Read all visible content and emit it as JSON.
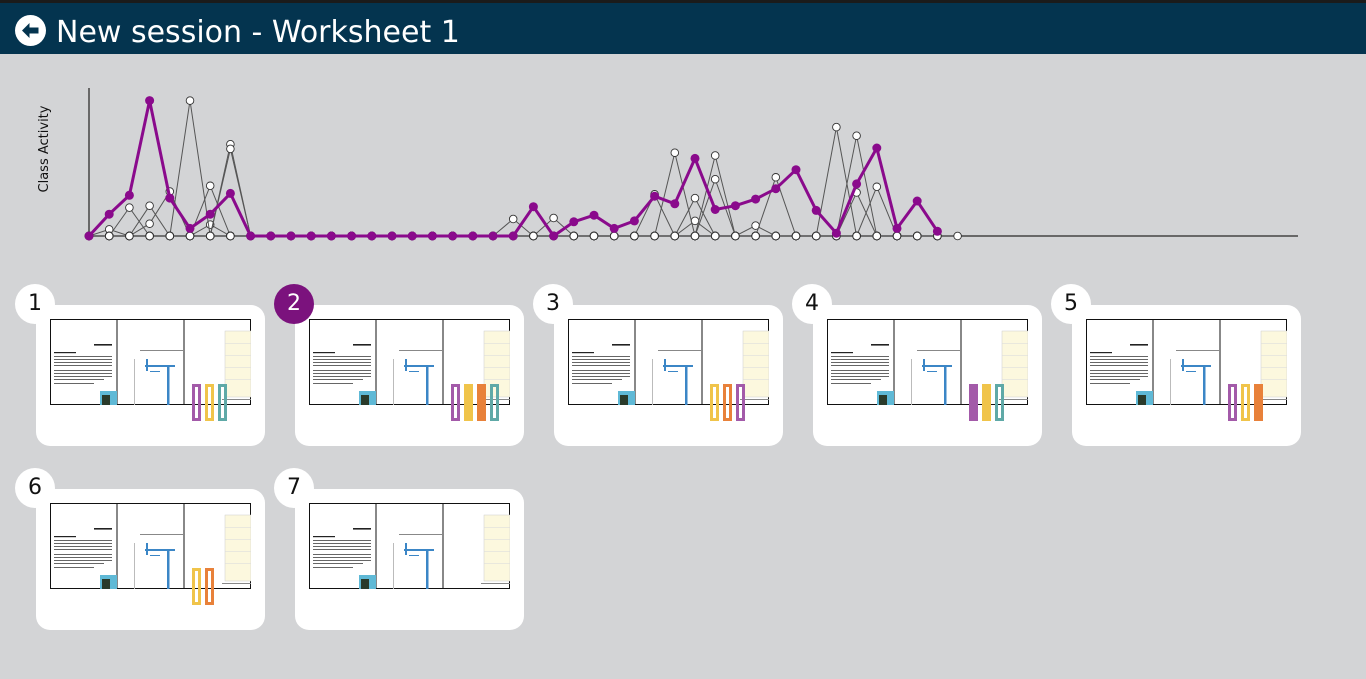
{
  "header": {
    "title": "New session - Worksheet 1",
    "back_icon": "back-arrow-icon"
  },
  "chart_data": {
    "type": "line",
    "ylabel": "Class Activity",
    "xlabel": "",
    "title": "",
    "x_count": 43,
    "ylim": [
      0,
      150
    ],
    "grid": false,
    "highlight_color": "#8a0a8c",
    "student_color": "#555555",
    "highlight": [
      0,
      23,
      43,
      143,
      40,
      8,
      23,
      45,
      0,
      0,
      0,
      0,
      0,
      0,
      0,
      0,
      0,
      0,
      0,
      0,
      0,
      0,
      31,
      0,
      15,
      22,
      8,
      16,
      42,
      34,
      82,
      28,
      32,
      39,
      50,
      70,
      27,
      3,
      55,
      93,
      8,
      37,
      5
    ],
    "students": [
      [
        0,
        7,
        0,
        0,
        0,
        0,
        12,
        0,
        0,
        0,
        0,
        0,
        0,
        0,
        0,
        0,
        0,
        0,
        0,
        0,
        0,
        0,
        0,
        0,
        0,
        0,
        0,
        0,
        0,
        0,
        16,
        0,
        0,
        11,
        0,
        0,
        0,
        0,
        46,
        0,
        0,
        0,
        0
      ],
      [
        0,
        0,
        30,
        0,
        0,
        0,
        0,
        0,
        0,
        0,
        0,
        0,
        0,
        0,
        0,
        0,
        0,
        0,
        0,
        0,
        0,
        0,
        0,
        0,
        0,
        0,
        0,
        0,
        0,
        0,
        40,
        0,
        0,
        0,
        0,
        0,
        0,
        0,
        0,
        0,
        0,
        0,
        0
      ],
      [
        0,
        0,
        0,
        0,
        0,
        143,
        0,
        0,
        0,
        0,
        0,
        0,
        0,
        0,
        0,
        0,
        0,
        0,
        0,
        0,
        0,
        0,
        0,
        0,
        0,
        0,
        0,
        0,
        0,
        0,
        0,
        0,
        0,
        0,
        0,
        0,
        0,
        115,
        0,
        0,
        0,
        0,
        0
      ],
      [
        0,
        0,
        0,
        0,
        0,
        0,
        0,
        97,
        0,
        0,
        0,
        0,
        0,
        0,
        0,
        0,
        0,
        0,
        0,
        0,
        0,
        0,
        0,
        0,
        0,
        0,
        0,
        0,
        0,
        0,
        0,
        0,
        0,
        0,
        0,
        0,
        0,
        0,
        106,
        0,
        0,
        0,
        0
      ],
      [
        0,
        0,
        0,
        32,
        0,
        0,
        0,
        0,
        0,
        0,
        0,
        0,
        0,
        0,
        0,
        0,
        0,
        0,
        0,
        0,
        0,
        0,
        0,
        0,
        0,
        0,
        0,
        0,
        0,
        0,
        0,
        0,
        0,
        0,
        0,
        0,
        0,
        0,
        0,
        0,
        0,
        0,
        0
      ],
      [
        0,
        0,
        0,
        0,
        0,
        0,
        53,
        0,
        0,
        0,
        0,
        0,
        0,
        0,
        0,
        0,
        0,
        0,
        0,
        0,
        0,
        0,
        0,
        0,
        0,
        0,
        0,
        0,
        0,
        0,
        0,
        0,
        0,
        0,
        0,
        0,
        0,
        0,
        0,
        0,
        0,
        0,
        0
      ],
      [
        0,
        0,
        0,
        0,
        0,
        0,
        0,
        92,
        0,
        0,
        0,
        0,
        0,
        0,
        0,
        0,
        0,
        0,
        0,
        0,
        0,
        0,
        0,
        0,
        0,
        0,
        0,
        0,
        0,
        0,
        0,
        0,
        0,
        0,
        0,
        0,
        0,
        0,
        0,
        0,
        0,
        0,
        0
      ],
      [
        0,
        0,
        0,
        13,
        47,
        0,
        0,
        0,
        0,
        0,
        0,
        0,
        0,
        0,
        0,
        0,
        0,
        0,
        0,
        0,
        0,
        0,
        0,
        0,
        0,
        0,
        0,
        0,
        0,
        0,
        0,
        0,
        0,
        0,
        0,
        0,
        0,
        0,
        0,
        0,
        0,
        0,
        0
      ],
      [
        0,
        0,
        0,
        0,
        0,
        0,
        0,
        0,
        0,
        0,
        0,
        0,
        0,
        0,
        0,
        0,
        0,
        0,
        0,
        0,
        0,
        18,
        0,
        0,
        0,
        0,
        0,
        0,
        0,
        0,
        0,
        0,
        0,
        0,
        0,
        0,
        0,
        0,
        0,
        0,
        0,
        0,
        0
      ],
      [
        0,
        0,
        0,
        0,
        0,
        0,
        0,
        0,
        0,
        0,
        0,
        0,
        0,
        0,
        0,
        0,
        0,
        0,
        0,
        0,
        0,
        0,
        0,
        19,
        0,
        0,
        0,
        0,
        0,
        0,
        0,
        0,
        0,
        0,
        0,
        0,
        0,
        0,
        0,
        0,
        0,
        0,
        0
      ],
      [
        0,
        0,
        0,
        0,
        0,
        0,
        0,
        0,
        0,
        0,
        0,
        0,
        0,
        0,
        0,
        0,
        0,
        0,
        0,
        0,
        0,
        0,
        0,
        0,
        0,
        0,
        0,
        0,
        44,
        0,
        0,
        0,
        0,
        0,
        0,
        0,
        0,
        0,
        0,
        0,
        0,
        0,
        0
      ],
      [
        0,
        0,
        0,
        0,
        0,
        0,
        0,
        0,
        0,
        0,
        0,
        0,
        0,
        0,
        0,
        0,
        0,
        0,
        0,
        0,
        0,
        0,
        0,
        0,
        0,
        0,
        0,
        0,
        0,
        88,
        0,
        0,
        0,
        0,
        0,
        0,
        0,
        0,
        0,
        0,
        0,
        0,
        0
      ],
      [
        0,
        0,
        0,
        0,
        0,
        0,
        0,
        0,
        0,
        0,
        0,
        0,
        0,
        0,
        0,
        0,
        0,
        0,
        0,
        0,
        0,
        0,
        0,
        0,
        0,
        0,
        0,
        0,
        0,
        0,
        0,
        85,
        0,
        0,
        0,
        0,
        0,
        0,
        0,
        0,
        0,
        0,
        0
      ],
      [
        0,
        0,
        0,
        0,
        0,
        0,
        0,
        0,
        0,
        0,
        0,
        0,
        0,
        0,
        0,
        0,
        0,
        0,
        0,
        0,
        0,
        0,
        0,
        0,
        0,
        0,
        0,
        0,
        0,
        0,
        0,
        60,
        0,
        0,
        0,
        0,
        0,
        0,
        0,
        0,
        0,
        0,
        0
      ],
      [
        0,
        0,
        0,
        0,
        0,
        0,
        0,
        0,
        0,
        0,
        0,
        0,
        0,
        0,
        0,
        0,
        0,
        0,
        0,
        0,
        0,
        0,
        0,
        0,
        0,
        0,
        0,
        0,
        0,
        0,
        0,
        0,
        0,
        0,
        62,
        0,
        0,
        0,
        0,
        0,
        0,
        0,
        0,
        0
      ],
      [
        0,
        0,
        0,
        0,
        0,
        0,
        0,
        0,
        0,
        0,
        0,
        0,
        0,
        0,
        0,
        0,
        0,
        0,
        0,
        0,
        0,
        0,
        0,
        0,
        0,
        0,
        0,
        0,
        0,
        0,
        0,
        0,
        0,
        0,
        0,
        0,
        0,
        0,
        0,
        52,
        0,
        0,
        0
      ]
    ]
  },
  "cards": [
    {
      "number": "1",
      "active": false,
      "markers": [
        {
          "color": "#a35aa9",
          "filled": false
        },
        {
          "color": "#f0c44a",
          "filled": false
        },
        {
          "color": "#5fa9a7",
          "filled": false
        }
      ]
    },
    {
      "number": "2",
      "active": true,
      "markers": [
        {
          "color": "#a35aa9",
          "filled": false
        },
        {
          "color": "#f0c44a",
          "filled": true
        },
        {
          "color": "#e8813a",
          "filled": true
        },
        {
          "color": "#5fa9a7",
          "filled": false
        }
      ]
    },
    {
      "number": "3",
      "active": false,
      "markers": [
        {
          "color": "#f0c44a",
          "filled": false
        },
        {
          "color": "#e8813a",
          "filled": false
        },
        {
          "color": "#a35aa9",
          "filled": false
        }
      ]
    },
    {
      "number": "4",
      "active": false,
      "markers": [
        {
          "color": "#a35aa9",
          "filled": true
        },
        {
          "color": "#f0c44a",
          "filled": true
        },
        {
          "color": "#5fa9a7",
          "filled": false
        }
      ]
    },
    {
      "number": "5",
      "active": false,
      "markers": [
        {
          "color": "#a35aa9",
          "filled": false
        },
        {
          "color": "#f0c44a",
          "filled": false
        },
        {
          "color": "#e8813a",
          "filled": true
        }
      ]
    },
    {
      "number": "6",
      "active": false,
      "markers": [
        {
          "color": "#f0c44a",
          "filled": false
        },
        {
          "color": "#e8813a",
          "filled": false
        }
      ]
    },
    {
      "number": "7",
      "active": false,
      "markers": []
    }
  ]
}
